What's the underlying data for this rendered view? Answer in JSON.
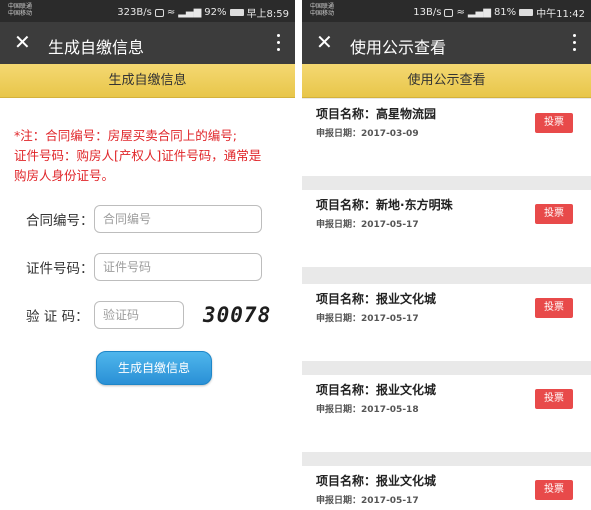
{
  "left": {
    "status": {
      "carrier_line1": "中国联通",
      "carrier_line2": "中国移动",
      "right_text": "323B/s",
      "battery": "92%",
      "time": "早上8:59"
    },
    "title": "生成自缴信息",
    "header": "生成自缴信息",
    "note_line1": "*注：合同编号：房屋买卖合同上的编号;",
    "note_line2": "证件号码：购房人[产权人]证件号码，通常是",
    "note_line3": "购房人身份证号。",
    "form": {
      "contract_label": "合同编号：",
      "contract_placeholder": "合同编号",
      "id_label": "证件号码：",
      "id_placeholder": "证件号码",
      "code_label": "验 证 码：",
      "code_placeholder": "验证码",
      "captcha": "30078"
    },
    "submit_label": "生成自缴信息"
  },
  "right": {
    "status": {
      "carrier_line1": "中国联通",
      "carrier_line2": "中国移动",
      "right_text": "13B/s",
      "battery": "81%",
      "time": "中午11:42"
    },
    "title": "使用公示查看",
    "header": "使用公示查看",
    "name_prefix": "项目名称：",
    "date_prefix": "申报日期：",
    "vote_label": "投票",
    "cards": [
      {
        "name": "高星物流园",
        "date": "2017-03-09"
      },
      {
        "name": "新地·东方明珠",
        "date": "2017-05-17"
      },
      {
        "name": "报业文化城",
        "date": "2017-05-17"
      },
      {
        "name": "报业文化城",
        "date": "2017-05-18"
      },
      {
        "name": "报业文化城",
        "date": "2017-05-17"
      }
    ]
  }
}
